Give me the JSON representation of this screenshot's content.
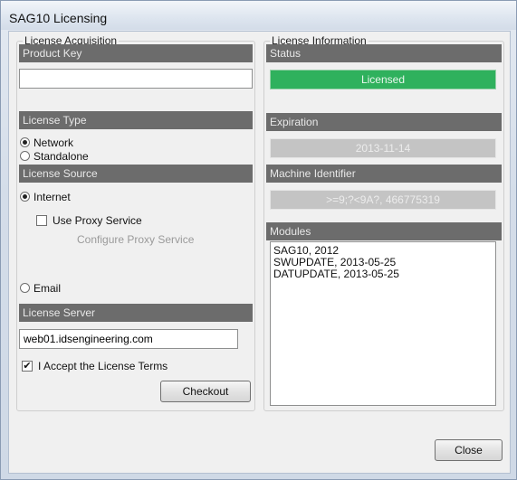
{
  "window": {
    "title": "SAG10 Licensing"
  },
  "acquisition": {
    "group_label": "License Acquisition",
    "product_key": {
      "header": "Product Key",
      "value": ""
    },
    "license_type": {
      "header": "License Type",
      "options": [
        "Network",
        "Standalone"
      ],
      "selected": "Network"
    },
    "license_source": {
      "header": "License Source",
      "internet_label": "Internet",
      "internet_selected": true,
      "use_proxy_label": "Use Proxy Service",
      "use_proxy_checked": false,
      "configure_proxy_label": "Configure Proxy Service",
      "email_label": "Email",
      "email_selected": false
    },
    "license_server": {
      "header": "License Server",
      "value": "web01.idsengineering.com"
    },
    "accept_terms_label": "I Accept the License Terms",
    "accept_terms_checked": true,
    "checkout_label": "Checkout"
  },
  "information": {
    "group_label": "License Information",
    "status": {
      "header": "Status",
      "value": "Licensed",
      "color": "#2fb15d"
    },
    "expiration": {
      "header": "Expiration",
      "value": "2013-11-14"
    },
    "machine_identifier": {
      "header": "Machine Identifier",
      "value": ">=9;?<9A?, 466775319"
    },
    "modules": {
      "header": "Modules",
      "items": [
        "SAG10, 2012",
        "SWUPDATE, 2013-05-25",
        "DATUPDATE, 2013-05-25"
      ]
    }
  },
  "footer": {
    "close_label": "Close"
  }
}
